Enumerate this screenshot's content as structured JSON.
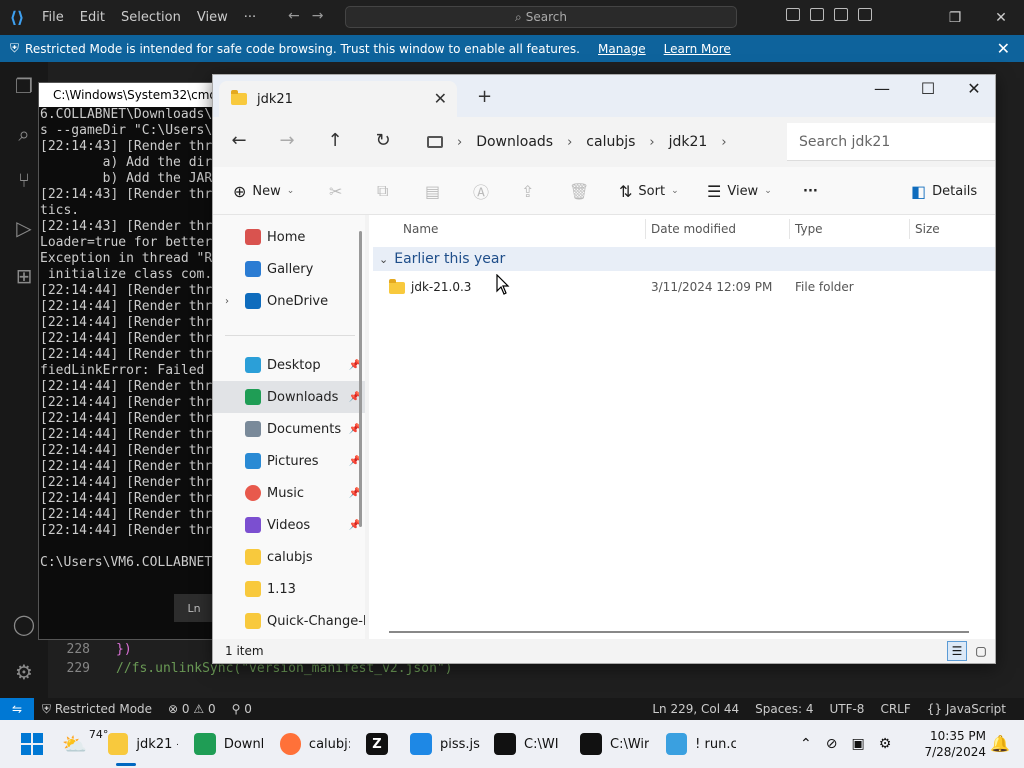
{
  "vscode": {
    "menu": [
      "File",
      "Edit",
      "Selection",
      "View",
      "···"
    ],
    "search_label": "Search",
    "banner": {
      "text": "Restricted Mode is intended for safe code browsing. Trust this window to enable all features.",
      "manage": "Manage",
      "learn_more": "Learn More"
    },
    "code_lines": [
      {
        "num": "228",
        "text": "})"
      },
      {
        "num": "229",
        "text": "//fs.unlinkSync(\"version_manifest_v2.json\")"
      }
    ],
    "status": {
      "restricted": "Restricted Mode",
      "errors": "0",
      "warnings": "0",
      "ports": "0",
      "position": "Ln 229, Col 44",
      "spaces": "Spaces: 4",
      "encoding": "UTF-8",
      "eol": "CRLF",
      "language": "JavaScript"
    },
    "ln_popup": "Ln"
  },
  "cmd": {
    "title": "C:\\Windows\\System32\\cmd",
    "lines": [
      "6.COLLABNET\\Downloads\\",
      "s --gameDir \"C:\\Users\\",
      "[22:14:43] [Render thr",
      "        a) Add the dir",
      "        b) Add the JAR",
      "[22:14:43] [Render thr",
      "tics.",
      "[22:14:43] [Render thr",
      "Loader=true for better",
      "Exception in thread \"R",
      " initialize class com.",
      "[22:14:44] [Render thr",
      "[22:14:44] [Render thr",
      "[22:14:44] [Render thr",
      "[22:14:44] [Render thr",
      "[22:14:44] [Render thr",
      "fiedLinkError: Failed",
      "[22:14:44] [Render thr",
      "[22:14:44] [Render thr",
      "[22:14:44] [Render thr",
      "[22:14:44] [Render thr",
      "[22:14:44] [Render thr",
      "[22:14:44] [Render thr",
      "[22:14:44] [Render thr",
      "[22:14:44] [Render thr",
      "[22:14:44] [Render thr",
      "[22:14:44] [Render thr",
      "",
      "C:\\Users\\VM6.COLLABNET"
    ]
  },
  "explorer": {
    "tab_title": "jdk21",
    "breadcrumbs": [
      "Downloads",
      "calubjs",
      "jdk21"
    ],
    "search_placeholder": "Search jdk21",
    "toolbar": {
      "new": "New",
      "sort": "Sort",
      "view": "View",
      "more": "···",
      "details": "Details"
    },
    "nav": [
      {
        "label": "Home",
        "color": "#d9534f"
      },
      {
        "label": "Gallery",
        "color": "#2b7cd3"
      },
      {
        "label": "OneDrive",
        "color": "#0f6cbd"
      },
      {
        "label": "Desktop",
        "color": "#2b9fd8"
      },
      {
        "label": "Downloads",
        "color": "#1f9d55"
      },
      {
        "label": "Documents",
        "color": "#7a8a9a"
      },
      {
        "label": "Pictures",
        "color": "#2a8ad4"
      },
      {
        "label": "Music",
        "color": "#e8594c"
      },
      {
        "label": "Videos",
        "color": "#7b4fd0"
      },
      {
        "label": "calubjs",
        "color": "#f8c93d"
      },
      {
        "label": "1.13",
        "color": "#f8c93d"
      },
      {
        "label": "Quick-Change-I",
        "color": "#f8c93d"
      }
    ],
    "columns": [
      "Name",
      "Date modified",
      "Type",
      "Size"
    ],
    "group": "Earlier this year",
    "files": [
      {
        "name": "jdk-21.0.3",
        "date": "3/11/2024 12:09 PM",
        "type": "File folder",
        "size": ""
      }
    ],
    "status": "1 item"
  },
  "taskbar": {
    "weather": "74°",
    "apps": [
      {
        "label": "jdk21 -",
        "icon": "folder",
        "color": "#f8c93d"
      },
      {
        "label": "Downl",
        "icon": "download",
        "color": "#1f9d55"
      },
      {
        "label": "calubj:",
        "icon": "firefox",
        "color": "#ff7139"
      },
      {
        "label": "",
        "icon": "Z",
        "color": "#111111"
      },
      {
        "label": "piss.js",
        "icon": "vscode",
        "color": "#1e88e5"
      },
      {
        "label": "C:\\WI",
        "icon": "cmd",
        "color": "#111111"
      },
      {
        "label": "C:\\Wir",
        "icon": "cmd",
        "color": "#111111"
      },
      {
        "label": "! run.c",
        "icon": "notepad",
        "color": "#3aa0e0"
      }
    ],
    "time": "10:35 PM",
    "date": "7/28/2024"
  }
}
